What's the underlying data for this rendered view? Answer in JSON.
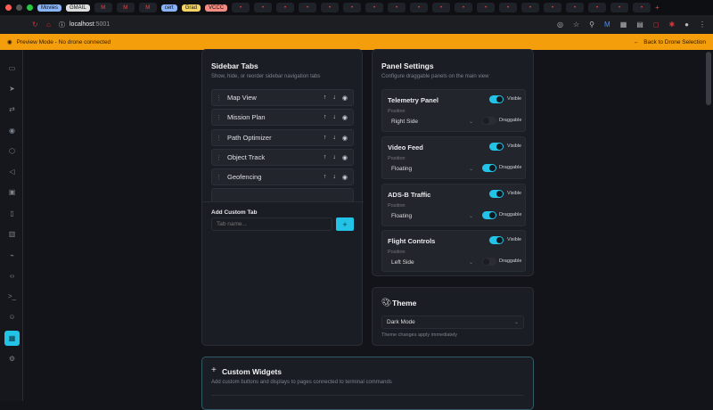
{
  "browser": {
    "bookmarks": [
      "Movies",
      "GMAIL",
      "cert",
      "Grad",
      "VCCC"
    ],
    "url_host": "localhost",
    "url_port": ":5001"
  },
  "banner": {
    "message": "Preview Mode - No drone connected",
    "back": "Back to Drone Selection"
  },
  "sidebar_tabs": {
    "title": "Sidebar Tabs",
    "subtitle": "Show, hide, or reorder sidebar navigation tabs",
    "items": [
      "Map View",
      "Mission Plan",
      "Path Optimizer",
      "Object Track",
      "Geofencing"
    ],
    "add_label": "Add Custom Tab",
    "placeholder": "Tab name...",
    "add_button": "+"
  },
  "panel_settings": {
    "title": "Panel Settings",
    "subtitle": "Configure draggable panels on the main view",
    "position_label": "Position",
    "visible_label": "Visible",
    "draggable_label": "Draggable",
    "panels": [
      {
        "name": "Telemetry Panel",
        "position": "Right Side",
        "visible": true,
        "draggable": false
      },
      {
        "name": "Video Feed",
        "position": "Floating",
        "visible": true,
        "draggable": true
      },
      {
        "name": "ADS-B Traffic",
        "position": "Floating",
        "visible": true,
        "draggable": true
      },
      {
        "name": "Flight Controls",
        "position": "Left Side",
        "visible": true,
        "draggable": false
      }
    ]
  },
  "theme": {
    "title": "Theme",
    "value": "Dark Mode",
    "hint": "Theme changes apply immediately"
  },
  "custom_widgets": {
    "title": "Custom Widgets",
    "subtitle": "Add custom buttons and displays to pages connected to terminal commands"
  },
  "colors": {
    "accent": "#22c3e6",
    "banner": "#f59e0b"
  }
}
